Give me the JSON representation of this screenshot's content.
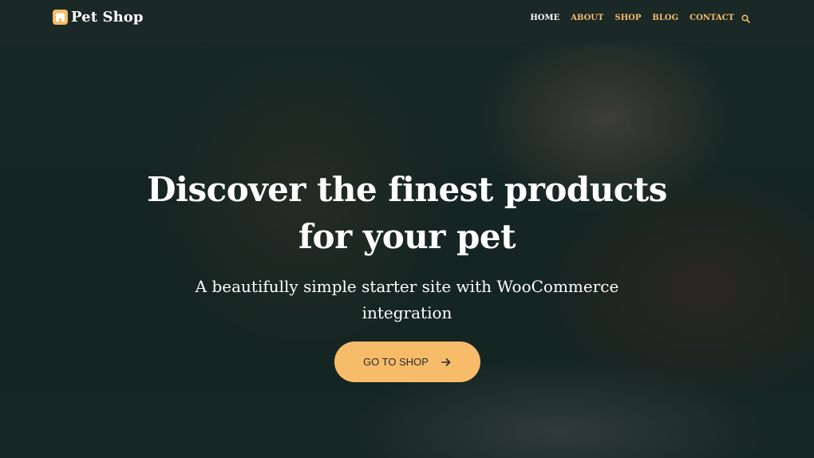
{
  "header": {
    "logo_text": "Pet Shop",
    "logo_icon": "shop-icon",
    "nav": [
      {
        "label": "HOME",
        "active": true
      },
      {
        "label": "ABOUT",
        "active": false
      },
      {
        "label": "SHOP",
        "active": false
      },
      {
        "label": "BLOG",
        "active": false
      },
      {
        "label": "CONTACT",
        "active": false
      }
    ],
    "search_icon": "search-icon"
  },
  "hero": {
    "title": "Discover the finest products for your pet",
    "subtitle": "A beautifully simple starter site with WooCommerce integration",
    "cta_label": "GO TO SHOP",
    "cta_icon": "arrow-right-icon"
  },
  "colors": {
    "accent": "#f7bc6a",
    "header_bg": "#1a2826",
    "text_light": "#ffffff"
  }
}
